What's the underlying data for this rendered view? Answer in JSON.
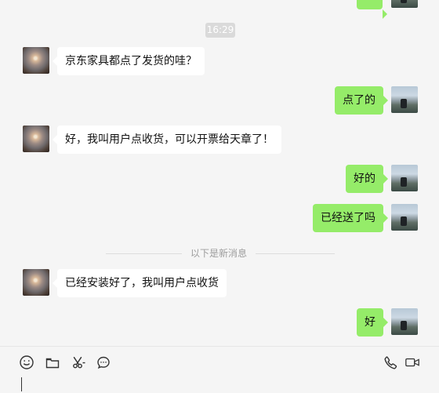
{
  "chat": {
    "timestamp": "16:29",
    "divider_text": "以下是新消息",
    "messages": [
      {
        "side": "out",
        "text": ""
      },
      {
        "side": "in",
        "text": "京东家具都点了发货的哇？"
      },
      {
        "side": "out",
        "text": "点了的"
      },
      {
        "side": "in",
        "text": "好，我叫用户点收货，可以开票给天章了！"
      },
      {
        "side": "out",
        "text": "好的"
      },
      {
        "side": "out",
        "text": "已经送了吗"
      },
      {
        "side": "in",
        "text": "已经安装好了，我叫用户点收货"
      },
      {
        "side": "out",
        "text": "好"
      }
    ]
  },
  "toolbar": {
    "icons": [
      "emoji-icon",
      "folder-icon",
      "scissors-icon",
      "chat-bubble-icon",
      "phone-icon",
      "video-icon"
    ]
  },
  "colors": {
    "background": "#f5f5f5",
    "bubble_in": "#ffffff",
    "bubble_out": "#95ec69",
    "time_badge": "#dadada"
  }
}
